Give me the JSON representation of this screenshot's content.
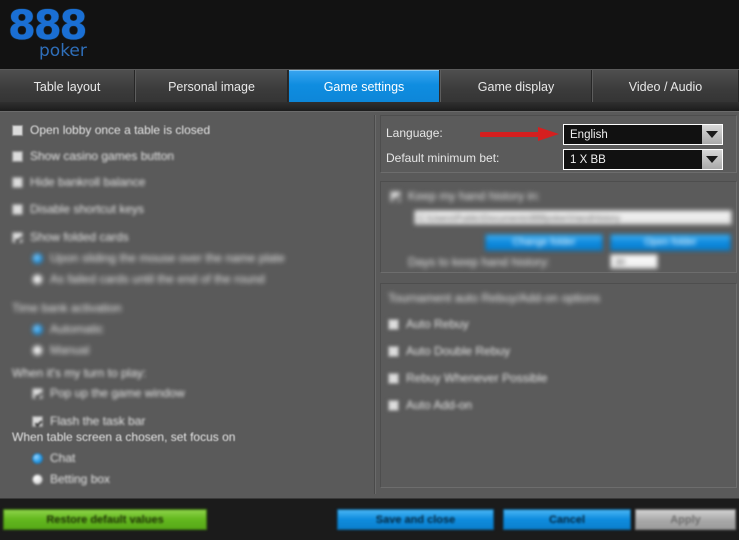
{
  "brand": {
    "logo_digits": "888",
    "logo_word": "poker",
    "logo_color": "#1a6fd4"
  },
  "tabs": [
    {
      "label": "Table layout",
      "active": false
    },
    {
      "label": "Personal image",
      "active": false
    },
    {
      "label": "Game settings",
      "active": true
    },
    {
      "label": "Game display",
      "active": false
    },
    {
      "label": "Video / Audio",
      "active": false
    }
  ],
  "left_panel": {
    "checkboxes": [
      {
        "label": "Open lobby once a table is closed",
        "checked": false
      },
      {
        "label": "Show casino games button",
        "checked": false
      },
      {
        "label": "Hide bankroll balance",
        "checked": false
      },
      {
        "label": "Disable shortcut keys",
        "checked": false
      },
      {
        "label": "Show folded cards",
        "checked": true
      }
    ],
    "folded_cards_options": [
      {
        "label": "Upon sliding the mouse over the name plate",
        "selected": true
      },
      {
        "label": "As failed cards until the end of the round",
        "selected": false
      }
    ],
    "time_bank_heading": "Time bank activation",
    "time_bank_options": [
      {
        "label": "Automatic",
        "selected": true
      },
      {
        "label": "Manual",
        "selected": false
      }
    ],
    "my_turn_heading": "When it's my turn to play:",
    "my_turn_checkboxes": [
      {
        "label": "Pop up the game window",
        "checked": true
      },
      {
        "label": "Flash the task bar",
        "checked": true
      }
    ],
    "focus_heading": "When table screen a chosen, set focus on",
    "focus_options": [
      {
        "label": "Chat",
        "selected": true
      },
      {
        "label": "Betting box",
        "selected": false
      }
    ]
  },
  "right_panel": {
    "language_label": "Language:",
    "language_value": "English",
    "min_bet_label": "Default minimum bet:",
    "min_bet_value": "1 X BB",
    "hand_history": {
      "checkbox_label": "Keep my hand history in:",
      "checkbox_checked": true,
      "path_value": "C:\\Users\\Public\\Documents\\888poker\\HandHistory",
      "change_folder_label": "Change folder",
      "open_folder_label": "Open folder",
      "days_label": "Days to keep hand history:",
      "days_value": "30"
    },
    "tournament": {
      "heading": "Tournament auto Rebuy/Add-on options",
      "options": [
        {
          "label": "Auto Rebuy",
          "checked": false
        },
        {
          "label": "Auto Double Rebuy",
          "checked": false
        },
        {
          "label": "Rebuy Whenever Possible",
          "checked": false
        },
        {
          "label": "Auto Add-on",
          "checked": false
        }
      ]
    }
  },
  "annotation": {
    "arrow_color": "#d51f1f",
    "points_to": "language-dropdown"
  },
  "footer": {
    "restore_label": "Restore default values",
    "save_label": "Save and close",
    "cancel_label": "Cancel",
    "apply_label": "Apply"
  }
}
